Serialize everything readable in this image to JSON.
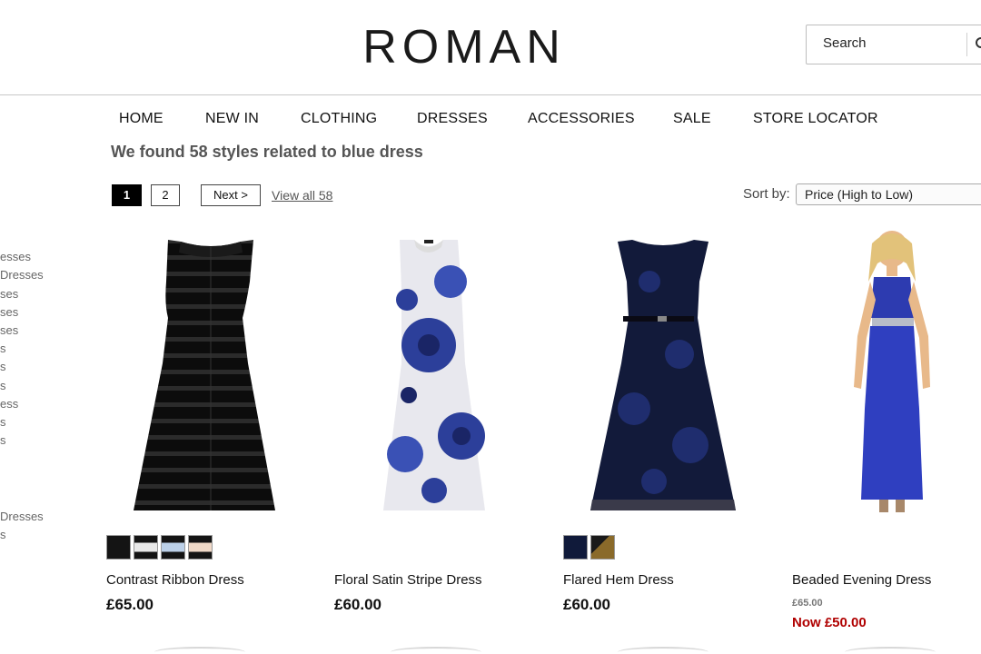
{
  "brand": {
    "logo_text": "ROMAN"
  },
  "search": {
    "placeholder": "Search",
    "value": "",
    "icon": "search-icon"
  },
  "nav": {
    "items": [
      "HOME",
      "NEW IN",
      "CLOTHING",
      "DRESSES",
      "ACCESSORIES",
      "SALE",
      "STORE LOCATOR"
    ]
  },
  "results": {
    "heading": "We found 58 styles related to blue dress"
  },
  "pagination": {
    "current_page": "1",
    "page_2": "2",
    "next_label": "Next >",
    "view_all_label": "View all 58"
  },
  "sort": {
    "label": "Sort by:",
    "selected": "Price (High to Low)"
  },
  "sidebar": {
    "items": [
      "esses",
      "Dresses",
      "ses",
      "ses",
      "ses",
      "s",
      "s",
      "s",
      "ess",
      "s",
      "s",
      "Dresses",
      "s"
    ]
  },
  "products": [
    {
      "name": "Contrast Ribbon Dress",
      "price": "£65.00",
      "swatch_colors": [
        "#141414",
        "#e9e9e9",
        "#bcd0e8",
        "#f0d9c8"
      ]
    },
    {
      "name": "Floral Satin Stripe Dress",
      "price": "£60.00",
      "swatch_colors": []
    },
    {
      "name": "Flared Hem Dress",
      "price": "£60.00",
      "swatch_colors": [
        "#101a3a",
        "#8a6a2a"
      ]
    },
    {
      "name": "Beaded Evening Dress",
      "was_price": "£65.00",
      "now_price": "Now £50.00",
      "swatch_colors": []
    }
  ],
  "colors": {
    "sale_red": "#b00000",
    "accent_black": "#000000"
  }
}
